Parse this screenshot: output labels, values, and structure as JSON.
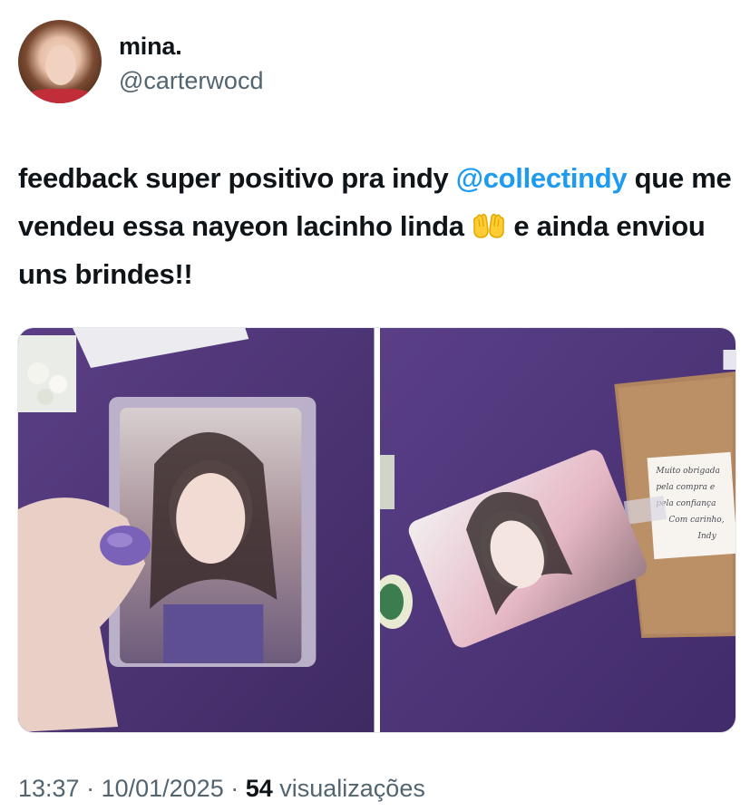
{
  "author": {
    "display_name": "mina.",
    "handle": "@carterwocd"
  },
  "tweet": {
    "text_part1": "feedback super positivo pra indy ",
    "mention": "@collectindy",
    "text_part2": " que me vendeu essa nayeon lacinho linda ",
    "emoji": "palms-up-together-emoji",
    "text_part3": " e ainda enviou uns brindes!!"
  },
  "media": {
    "photos": [
      {
        "icon": "photocard-in-sleeve-photo"
      },
      {
        "icon": "photocard-and-envelope-photo"
      }
    ],
    "note_lines": [
      "Muito obrigada",
      "pela compra e",
      "pela confiança",
      "Com carinho,",
      "Indy"
    ]
  },
  "meta": {
    "time": "13:37",
    "sep1": " · ",
    "date": "10/01/2025",
    "sep2": " · ",
    "views_count": "54",
    "views_label": " visualizações"
  },
  "colors": {
    "mention": "#1d9bf0",
    "secondary_text": "#536471",
    "primary_text": "#0f1419",
    "background": "#ffffff"
  }
}
